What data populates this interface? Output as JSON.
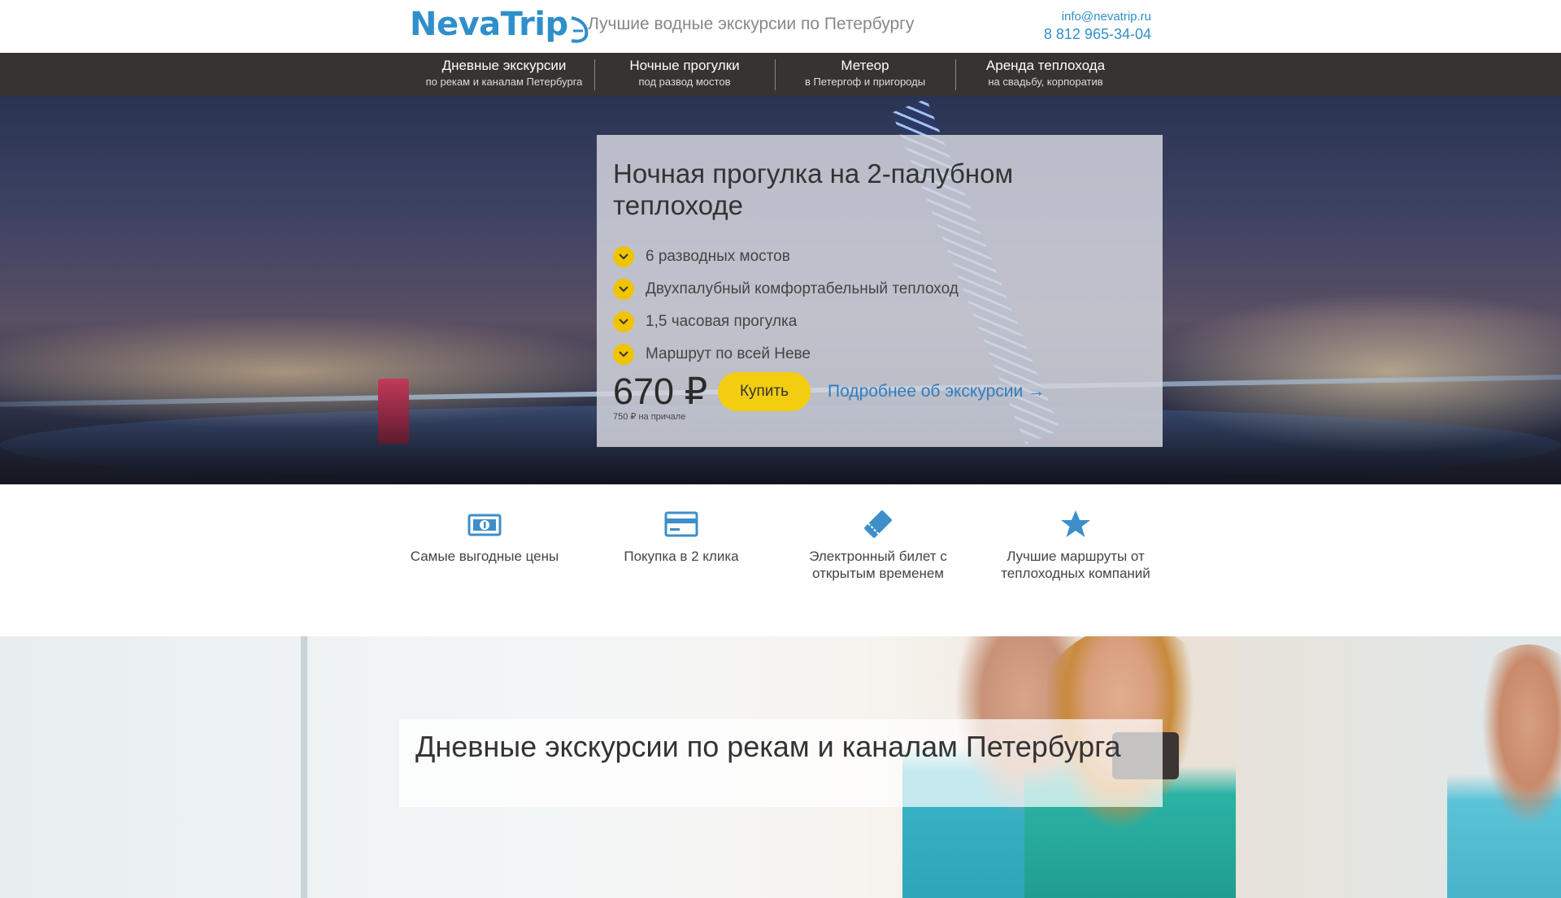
{
  "header": {
    "logo": "NevaTrip",
    "tagline": "Лучшие водные экскурсии по Петербургу",
    "email": "info@nevatrip.ru",
    "phone": "8 812 965-34-04"
  },
  "nav": {
    "items": [
      {
        "title": "Дневные экскурсии",
        "sub": "по рекам и каналам Петербурга"
      },
      {
        "title": "Ночные прогулки",
        "sub": "под развод мостов"
      },
      {
        "title": "Метеор",
        "sub": "в Петергоф и пригороды"
      },
      {
        "title": "Аренда теплохода",
        "sub": "на свадьбу, корпоратив"
      }
    ]
  },
  "hero": {
    "title": "Ночная прогулка на 2-палубном теплоходе",
    "features": [
      "6 разводных мостов",
      "Двухпалубный комфортабельный теплоход",
      "1,5 часовая прогулка",
      "Маршрут по всей Неве"
    ],
    "price": "670 ₽",
    "price_note": "750 ₽ на причале",
    "buy_label": "Купить",
    "more_label": "Подробнее об экскурсии →"
  },
  "benefits": [
    {
      "icon": "banknote-icon",
      "label": "Самые выгодные цены"
    },
    {
      "icon": "credit-card-icon",
      "label": "Покупка в 2 клика"
    },
    {
      "icon": "ticket-icon",
      "label": "Электронный билет с открытым временем"
    },
    {
      "icon": "star-icon",
      "label": "Лучшие маршруты от теплоходных компаний"
    }
  ],
  "day_section": {
    "title": "Дневные экскурсии по рекам и каналам Петербурга"
  },
  "colors": {
    "brand_blue": "#2f8fcb",
    "nav_bg": "#363331",
    "accent_yellow": "#f3cd10",
    "link_blue": "#2f7dc0"
  }
}
